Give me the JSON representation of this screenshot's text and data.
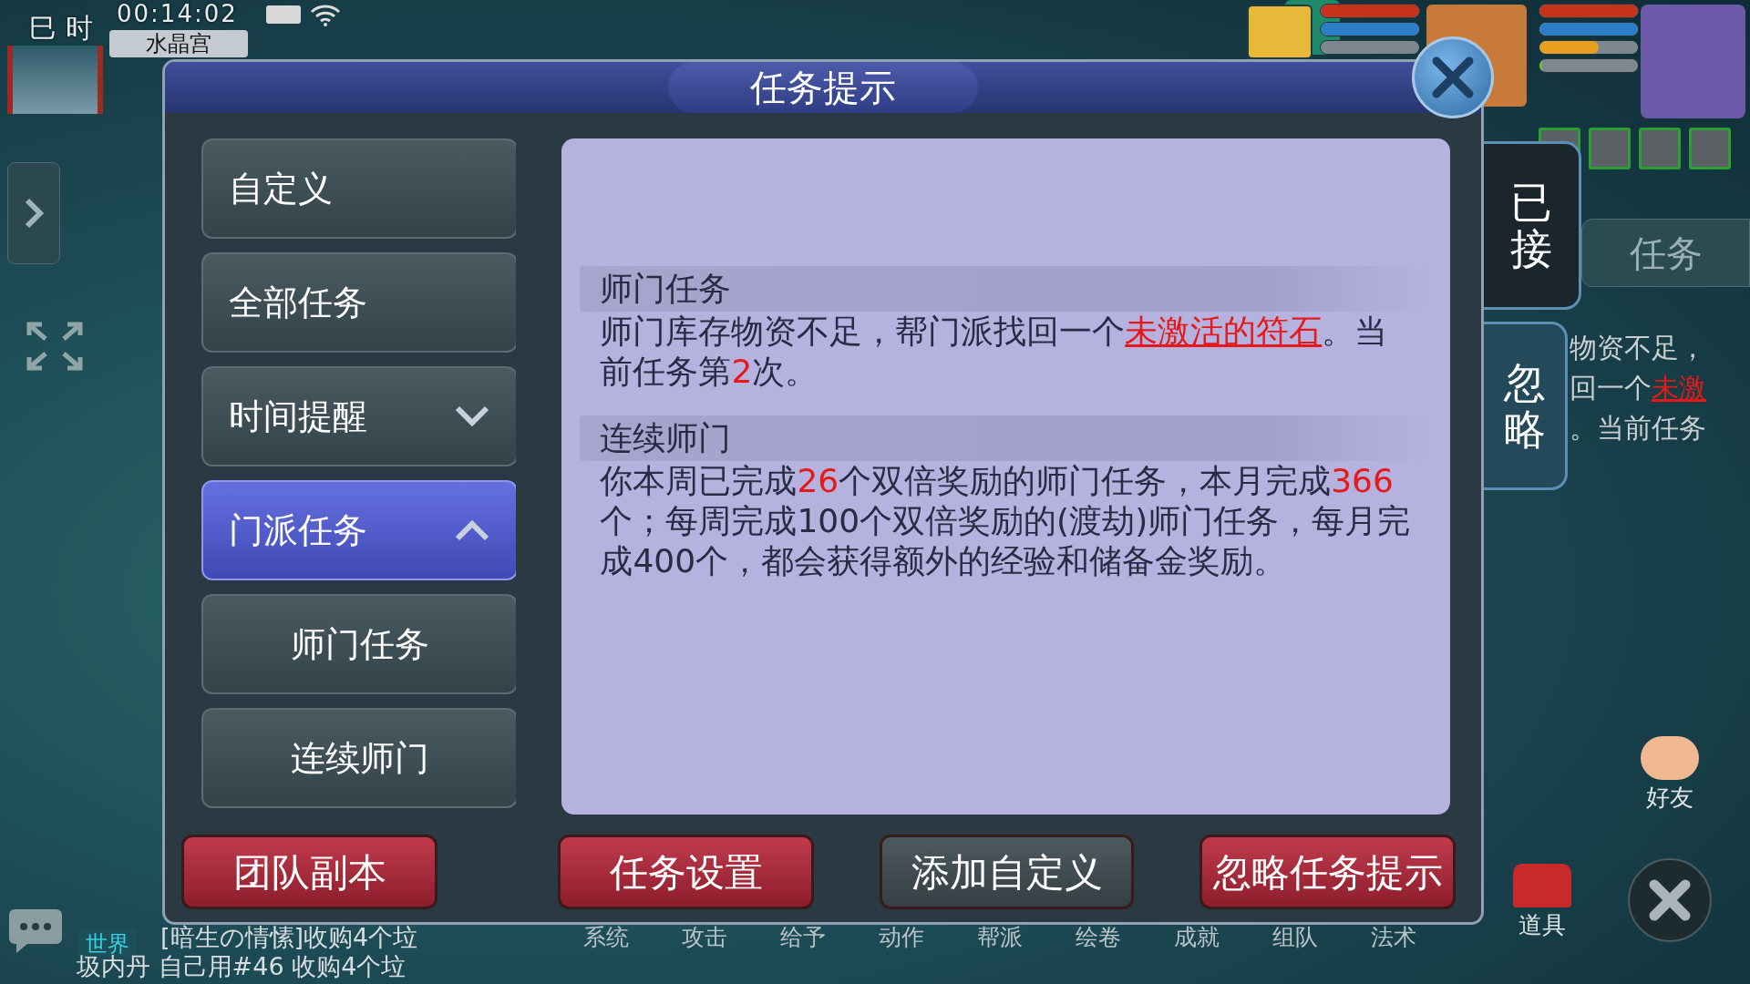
{
  "hud": {
    "period": "巳 时",
    "clock": "00:14:02",
    "location": "水晶宫"
  },
  "pet_bars": [
    {
      "kind": "hp",
      "level": 1
    },
    {
      "kind": "mp",
      "level": 1
    },
    {
      "kind": "exp",
      "level": 0
    }
  ],
  "player_bars": [
    {
      "kind": "hp",
      "level": 1
    },
    {
      "kind": "mp",
      "level": 1
    },
    {
      "kind": "rage",
      "level": 0.6
    },
    {
      "kind": "exp",
      "level": 0.03
    }
  ],
  "dialog": {
    "title": "任务提示",
    "menu": [
      {
        "label": "自定义",
        "selected": false
      },
      {
        "label": "全部任务",
        "selected": false
      },
      {
        "label": "时间提醒",
        "selected": false,
        "expanded": false
      },
      {
        "label": "门派任务",
        "selected": true,
        "expanded": true,
        "children": [
          {
            "label": "师门任务"
          },
          {
            "label": "连续师门"
          }
        ]
      }
    ],
    "sections": [
      {
        "heading": "师门任务",
        "text": [
          {
            "kind": "plain",
            "text": "师门库存物资不足，帮门派找回一个"
          },
          {
            "kind": "link",
            "text": "未激活的符石"
          },
          {
            "kind": "plain",
            "text": "。当前任务第"
          },
          {
            "kind": "number",
            "text": "2"
          },
          {
            "kind": "plain",
            "text": "次。"
          }
        ]
      },
      {
        "heading": "连续师门",
        "text": [
          {
            "kind": "plain",
            "text": "你本周已完成"
          },
          {
            "kind": "number",
            "text": "26"
          },
          {
            "kind": "plain",
            "text": "个双倍奖励的师门任务，本月完成"
          },
          {
            "kind": "number",
            "text": "366"
          },
          {
            "kind": "plain",
            "text": "个；每周完成100个双倍奖励的(渡劫)师门任务，每月完成400个，都会获得额外的经验和储备金奖励。"
          }
        ]
      }
    ],
    "buttons": [
      {
        "label": "团队副本",
        "kind": "primary"
      },
      {
        "label": "任务设置",
        "kind": "primary"
      },
      {
        "label": "添加自定义",
        "kind": "secondary"
      },
      {
        "label": "忽略任务提示",
        "kind": "primary"
      }
    ]
  },
  "side_tabs": [
    {
      "label": "已接",
      "selected": true
    },
    {
      "label": "忽略",
      "selected": false
    }
  ],
  "task_tracker": {
    "tab": "任务",
    "lines": [
      [
        {
          "kind": "plain",
          "text": "物资不足，"
        }
      ],
      [
        {
          "kind": "plain",
          "text": "回一个"
        },
        {
          "kind": "link",
          "text": "未激"
        }
      ],
      [
        {
          "kind": "plain",
          "text": "。当前任务"
        }
      ]
    ]
  },
  "quick_buttons": [
    {
      "label": "好友"
    },
    {
      "label": "道具"
    }
  ],
  "chat": {
    "channel": "世界",
    "lines": [
      "[暗生の情愫]收购4个垃",
      "圾内丹 自己用#46 收购4个垃"
    ]
  },
  "bottom_menu": [
    "系统",
    "攻击",
    "给予",
    "动作",
    "帮派",
    "绘卷",
    "成就",
    "组队",
    "法术"
  ]
}
